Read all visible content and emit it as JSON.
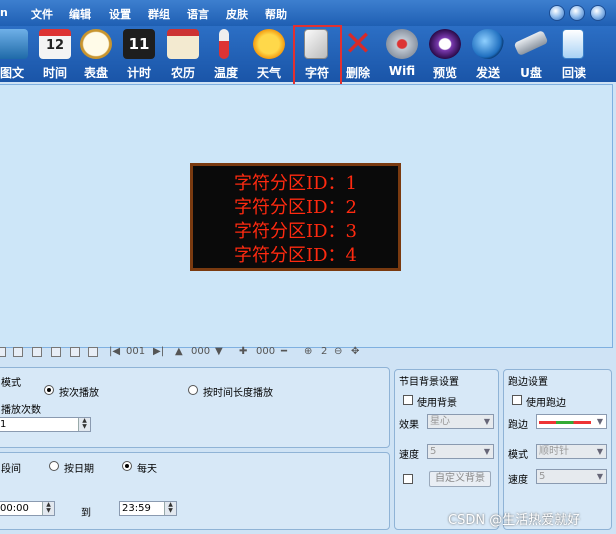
{
  "menu": {
    "cut_label": "n",
    "items": [
      "文件",
      "编辑",
      "设置",
      "群组",
      "语言",
      "皮肤",
      "帮助"
    ]
  },
  "toolbar": {
    "items": [
      {
        "label": "图文",
        "icon": "image-text-icon",
        "color": "#3a7fc8"
      },
      {
        "label": "时间",
        "icon": "calendar-icon",
        "color": "#e8e8e8"
      },
      {
        "label": "表盘",
        "icon": "clock-dial-icon",
        "color": "#e0b860"
      },
      {
        "label": "计时",
        "icon": "timer-icon",
        "color": "#202020"
      },
      {
        "label": "农历",
        "icon": "lunar-calendar-icon",
        "color": "#f0e6c8"
      },
      {
        "label": "温度",
        "icon": "thermometer-icon",
        "color": "#d04040"
      },
      {
        "label": "天气",
        "icon": "sun-icon",
        "color": "#f5b21c"
      },
      {
        "label": "字符",
        "icon": "character-icon",
        "color": "#eeeeee"
      },
      {
        "label": "删除",
        "icon": "delete-icon",
        "color": "#d82a2a"
      },
      {
        "label": "Wifi",
        "icon": "wifi-icon",
        "color": "#b0b8c4"
      },
      {
        "label": "预览",
        "icon": "preview-play-icon",
        "color": "#7a3ab0"
      },
      {
        "label": "发送",
        "icon": "send-globe-icon",
        "color": "#2a8ad8"
      },
      {
        "label": "U盘",
        "icon": "usb-drive-icon",
        "color": "#9aa2ae"
      },
      {
        "label": "回读",
        "icon": "read-back-icon",
        "color": "#4a9ae0"
      }
    ],
    "cut_label_uboard": "U盘"
  },
  "led": {
    "lines": [
      "字符分区ID：1",
      "字符分区ID：2",
      "字符分区ID：3",
      "字符分区ID：4"
    ]
  },
  "subbar": {
    "frame1": "001",
    "frame2": "000",
    "frame3": "000",
    "zoom": "2"
  },
  "play_panel": {
    "mode_title": "模式",
    "by_count": "按次播放",
    "by_duration": "按时间长度播放",
    "count_label": "播放次数",
    "count_value": "1"
  },
  "schedule_panel": {
    "period_label": "段间",
    "by_date": "按日期",
    "daily": "每天",
    "start_time": "00:00",
    "to": "到",
    "end_time": "23:59"
  },
  "bg_panel": {
    "title": "节目背景设置",
    "use_bg": "使用背景",
    "effect_label": "效果",
    "effect_value": "星心",
    "speed_label": "速度",
    "speed_value": "5",
    "custom_bg": "自定义背景"
  },
  "border_panel": {
    "title": "跑边设置",
    "use_border": "使用跑边",
    "border_label": "跑边",
    "mode_label": "模式",
    "mode_value": "顺时针",
    "speed_label": "速度",
    "speed_value": "5"
  },
  "watermark": "CSDN @生活热爱就好"
}
